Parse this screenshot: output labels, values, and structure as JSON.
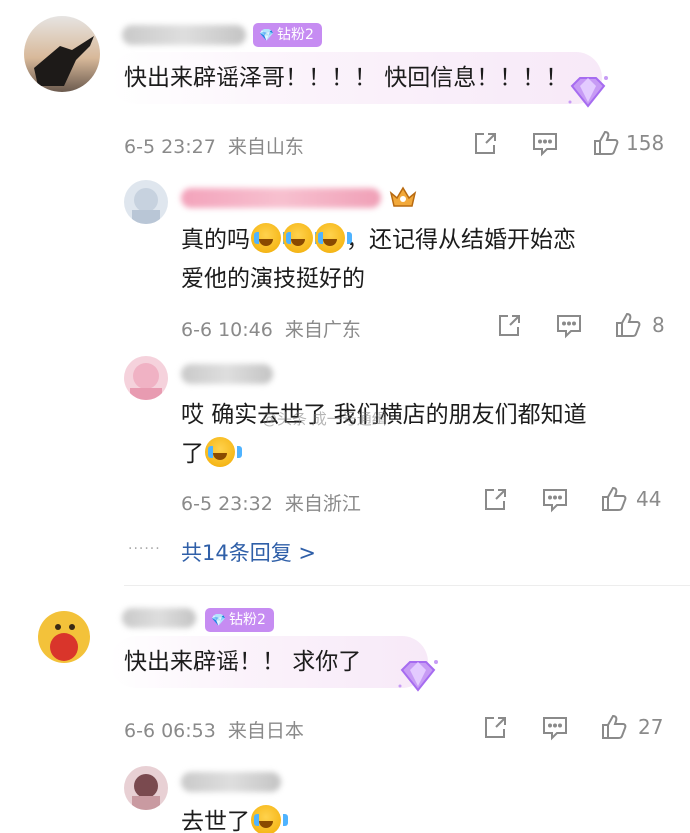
{
  "colors": {
    "badge_bg": "#c68cf2",
    "link": "#2f5fa8",
    "meta": "#8a8a8a"
  },
  "comments": [
    {
      "badge": "钻粉2",
      "text": "快出来辟谣泽哥！！！！ 快回信息！！！！",
      "time": "6-5 23:27",
      "location": "来自山东",
      "likes": "158"
    },
    {
      "badge": "钻粉2",
      "text": "快出来辟谣！！ 求你了",
      "time": "6-6 06:53",
      "location": "来自日本",
      "likes": "27"
    }
  ],
  "replies": [
    {
      "text_line1_pre": "真的吗",
      "text_line1_post": "，还记得从结婚开始恋",
      "text_line2": "爱他的演技挺好的",
      "time": "6-6 10:46",
      "location": "来自广东",
      "likes": "8"
    },
    {
      "text_line1": "哎 确实去世了 我们横店的朋友们都知道",
      "text_line2": "了",
      "time": "6-5 23:32",
      "location": "来自浙江",
      "likes": "44"
    },
    {
      "text": "去世了"
    }
  ],
  "more_replies": "共14条回复 >",
  "more_dots": "······",
  "watermark": "@头条 成一号通缉"
}
